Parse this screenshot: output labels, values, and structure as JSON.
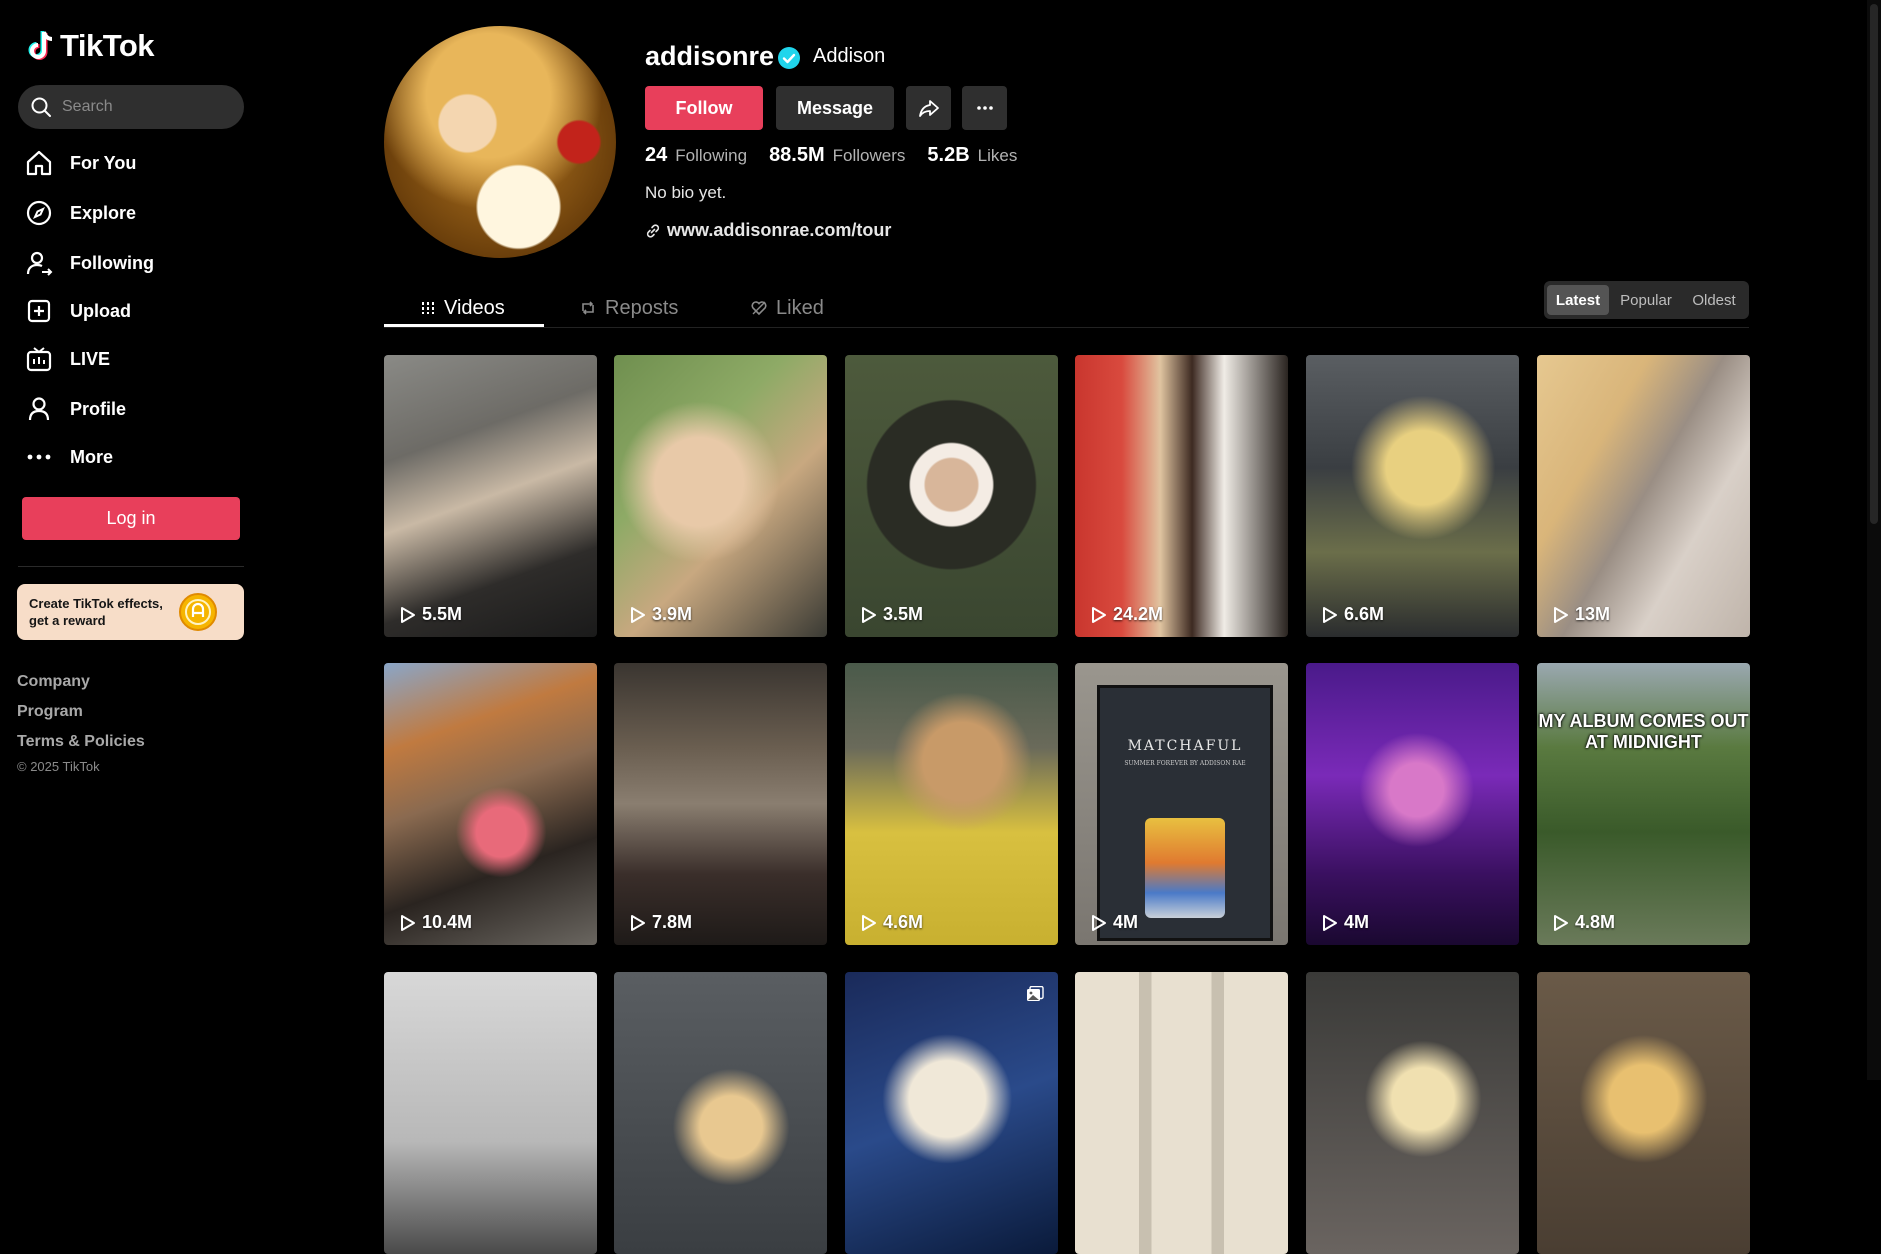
{
  "brand": {
    "name": "TikTok"
  },
  "search": {
    "placeholder": "Search"
  },
  "nav": [
    {
      "label": "For You",
      "icon": "home-icon"
    },
    {
      "label": "Explore",
      "icon": "compass-icon"
    },
    {
      "label": "Following",
      "icon": "following-icon"
    },
    {
      "label": "Upload",
      "icon": "upload-icon"
    },
    {
      "label": "LIVE",
      "icon": "live-icon"
    },
    {
      "label": "Profile",
      "icon": "profile-icon"
    },
    {
      "label": "More",
      "icon": "more-icon"
    }
  ],
  "login": {
    "label": "Log in"
  },
  "effects_card": {
    "line1": "Create TikTok effects,",
    "line2": "get a reward"
  },
  "footer": {
    "links": [
      "Company",
      "Program",
      "Terms & Policies"
    ],
    "copyright": "© 2025 TikTok"
  },
  "profile": {
    "username": "addisonre",
    "nickname": "Addison",
    "verified": true,
    "follow_label": "Follow",
    "message_label": "Message",
    "stats": {
      "following": {
        "value": "24",
        "label": "Following"
      },
      "followers": {
        "value": "88.5M",
        "label": "Followers"
      },
      "likes": {
        "value": "5.2B",
        "label": "Likes"
      }
    },
    "bio": "No bio yet.",
    "link": "www.addisonrae.com/tour"
  },
  "tabs": [
    {
      "label": "Videos",
      "active": true
    },
    {
      "label": "Reposts",
      "active": false
    },
    {
      "label": "Liked",
      "active": false
    }
  ],
  "sort": {
    "options": [
      "Latest",
      "Popular",
      "Oldest"
    ],
    "selected": "Latest"
  },
  "videos": [
    {
      "views": "5.5M"
    },
    {
      "views": "3.9M"
    },
    {
      "views": "3.5M"
    },
    {
      "views": "24.2M"
    },
    {
      "views": "6.6M"
    },
    {
      "views": "13M"
    },
    {
      "views": "10.4M"
    },
    {
      "views": "7.8M"
    },
    {
      "views": "4.6M"
    },
    {
      "views": "4M",
      "sign_title": "MATCHAFUL",
      "sign_subtitle": "SUMMER FOREVER BY ADDISON RAE"
    },
    {
      "views": "4M"
    },
    {
      "views": "4.8M",
      "caption_line1": "MY ALBUM COMES OUT",
      "caption_line2": "AT MIDNIGHT"
    },
    {
      "views": ""
    },
    {
      "views": ""
    },
    {
      "views": ""
    },
    {
      "views": ""
    },
    {
      "views": ""
    },
    {
      "views": ""
    }
  ],
  "colors": {
    "accent": "#e83f5b",
    "background": "#000000",
    "surface": "#2f2f2f",
    "verified": "#20d5ec"
  }
}
